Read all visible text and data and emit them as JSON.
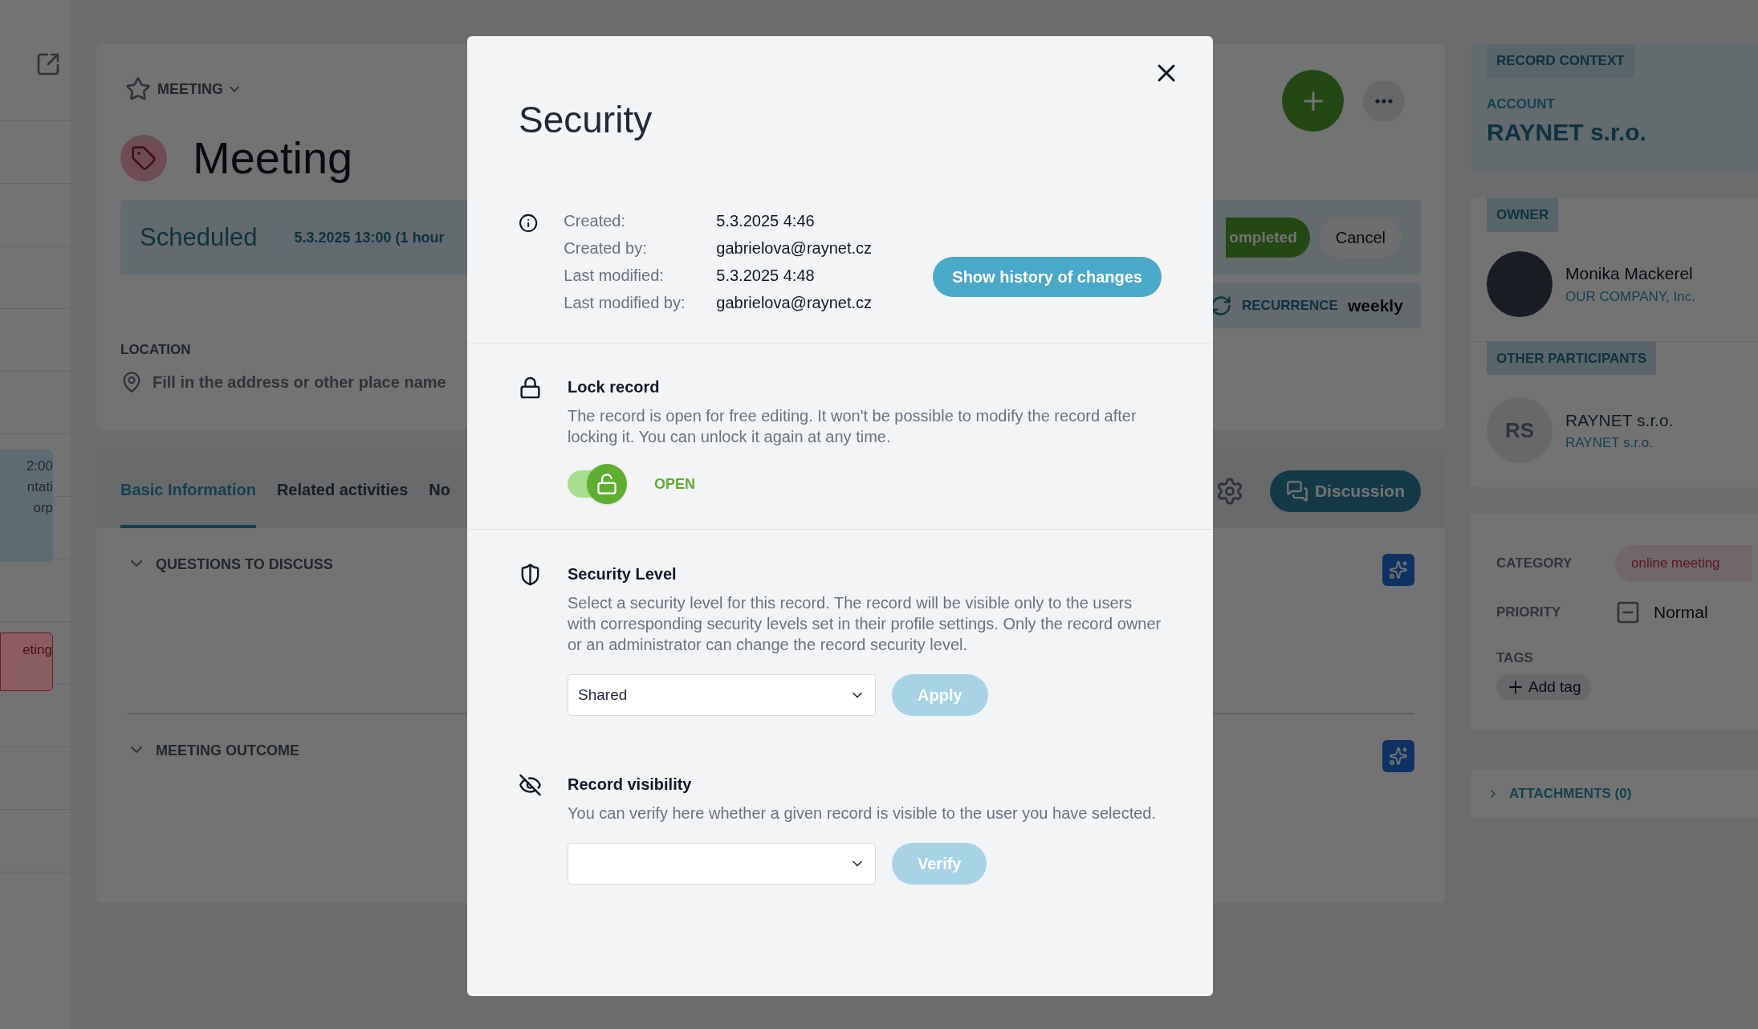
{
  "calendar": {
    "events": [
      {
        "lines": [
          "2:00",
          "ntati",
          "orp"
        ],
        "color": "#5f6b72"
      },
      {
        "lines": [
          "eting"
        ],
        "color": "#8a5d64"
      }
    ]
  },
  "record": {
    "type_label": "MEETING",
    "title": "Meeting",
    "status": "Scheduled",
    "datetime": "5.3.2025 13:00 (1 hour",
    "complete_button": "ompleted",
    "cancel_button": "Cancel",
    "recurrence_label": "RECURRENCE",
    "recurrence_value": "weekly",
    "location_label": "LOCATION",
    "location_placeholder": "Fill in the address or other place name"
  },
  "tabs": [
    {
      "label": "Basic Information",
      "selected": true
    },
    {
      "label": "Related activities",
      "selected": false
    },
    {
      "label": "No",
      "selected": false
    }
  ],
  "discussion_button": "Discussion",
  "sections": [
    {
      "title": "QUESTIONS TO DISCUSS",
      "expanded": true
    },
    {
      "title": "MEETING OUTCOME",
      "expanded": true
    }
  ],
  "side": {
    "record_context": {
      "tag": "RECORD CONTEXT",
      "label": "ACCOUNT",
      "value": "RAYNET s.r.o."
    },
    "owner": {
      "tag": "OWNER",
      "name": "Monika Mackerel",
      "company": "OUR COMPANY, Inc."
    },
    "other_participants": {
      "tag": "OTHER PARTICIPANTS",
      "initials": "RS",
      "name": "RAYNET s.r.o.",
      "company": "RAYNET s.r.o."
    },
    "details": {
      "category_label": "CATEGORY",
      "category_value": "online meeting",
      "priority_label": "PRIORITY",
      "priority_value": "Normal",
      "tags_label": "TAGS",
      "add_tag": "Add tag"
    },
    "attachments": {
      "label": "ATTACHMENTS (0)",
      "expanded": false
    }
  },
  "modal": {
    "title": "Security",
    "info_rows": [
      {
        "label": "Created:",
        "value": "5.3.2025 4:46"
      },
      {
        "label": "Created by:",
        "value": "gabrielova@raynet.cz"
      },
      {
        "label": "Last modified:",
        "value": "5.3.2025 4:48"
      },
      {
        "label": "Last modified by:",
        "value": "gabrielova@raynet.cz"
      }
    ],
    "history_button": "Show history of changes",
    "lock": {
      "title": "Lock record",
      "description": "The record is open for free editing. It won't be possible to modify the record after locking it. You can unlock it again at any time.",
      "open": true,
      "status": "OPEN"
    },
    "security_level": {
      "title": "Security Level",
      "description": "Select a security level for this record. The record will be visible only to the users with corresponding security levels set in their profile settings. Only the record owner or an administrator can change the record security level.",
      "select_value": "Shared",
      "button": {
        "label": "Apply",
        "disabled": true
      }
    },
    "visibility": {
      "title": "Record visibility",
      "description": "You can verify here whether a given record is visible to the user you have selected.",
      "button": {
        "label": "Verify",
        "disabled": true
      }
    }
  }
}
